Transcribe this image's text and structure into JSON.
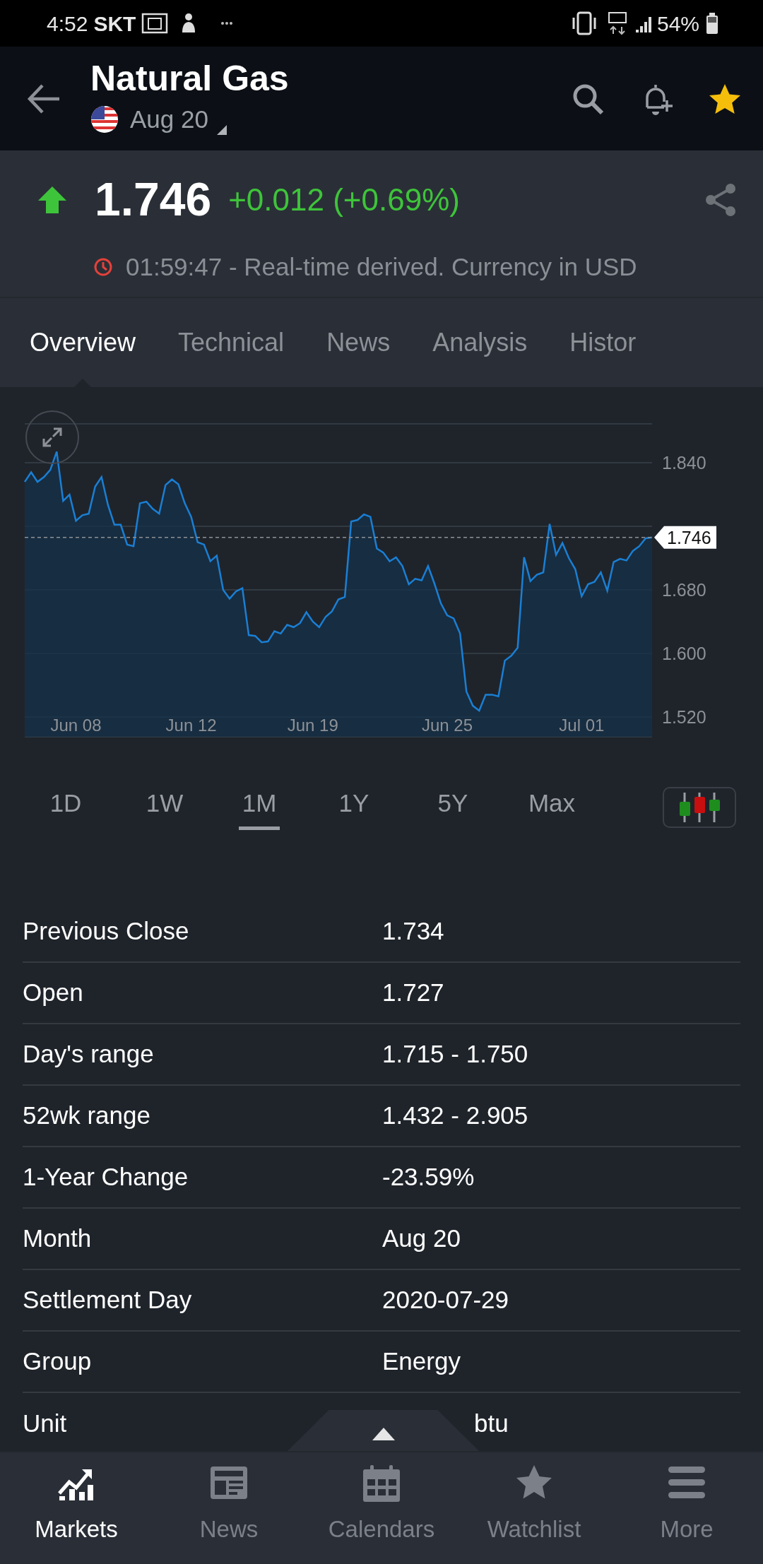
{
  "status_bar": {
    "time": "4:52",
    "carrier": "SKT",
    "battery": "54%"
  },
  "header": {
    "title": "Natural Gas",
    "contract": "Aug 20",
    "favorite": true
  },
  "quote": {
    "price": "1.746",
    "change": "+0.012 (+0.69%)",
    "up": true,
    "timestamp": "01:59:47 - Real-time derived. Currency in USD"
  },
  "tabs": [
    {
      "label": "Overview",
      "selected": true
    },
    {
      "label": "Technical",
      "selected": false
    },
    {
      "label": "News",
      "selected": false
    },
    {
      "label": "Analysis",
      "selected": false
    },
    {
      "label": "Histor",
      "selected": false
    }
  ],
  "chart": {
    "chart_data": {
      "type": "area",
      "ylim": [
        1.495,
        1.889
      ],
      "grid": true,
      "yticks": [
        {
          "value": 1.52,
          "label": "1.520"
        },
        {
          "value": 1.6,
          "label": "1.600"
        },
        {
          "value": 1.68,
          "label": "1.680"
        },
        {
          "value": 1.84,
          "label": "1.840"
        }
      ],
      "categories": [
        null,
        null,
        null,
        null,
        null,
        null,
        null,
        null,
        "Jun 08",
        null,
        null,
        null,
        null,
        null,
        null,
        null,
        null,
        null,
        null,
        null,
        null,
        null,
        null,
        null,
        null,
        null,
        "Jun 12",
        null,
        null,
        null,
        null,
        null,
        null,
        null,
        null,
        null,
        null,
        null,
        null,
        null,
        null,
        null,
        null,
        null,
        null,
        "Jun 19",
        null,
        null,
        null,
        null,
        null,
        null,
        null,
        null,
        null,
        null,
        null,
        null,
        null,
        null,
        null,
        null,
        null,
        null,
        null,
        null,
        "Jun 25",
        null,
        null,
        null,
        null,
        null,
        null,
        null,
        null,
        null,
        null,
        null,
        null,
        null,
        null,
        null,
        null,
        null,
        null,
        null,
        null,
        "Jul 01",
        null,
        null,
        null,
        null,
        null,
        null,
        null,
        null,
        null,
        null,
        null
      ],
      "series": [
        {
          "color": "#1a7fd4",
          "values": [
            1.816,
            1.828,
            1.816,
            1.822,
            1.831,
            1.854,
            1.792,
            1.8,
            1.767,
            1.774,
            1.776,
            1.81,
            1.822,
            1.787,
            1.762,
            1.762,
            1.737,
            1.735,
            1.789,
            1.791,
            1.782,
            1.776,
            1.812,
            1.819,
            1.813,
            1.789,
            1.772,
            1.74,
            1.737,
            1.716,
            1.723,
            1.68,
            1.669,
            1.678,
            1.682,
            1.623,
            1.622,
            1.614,
            1.615,
            1.628,
            1.625,
            1.636,
            1.633,
            1.638,
            1.652,
            1.64,
            1.633,
            1.646,
            1.653,
            1.668,
            1.671,
            1.766,
            1.768,
            1.775,
            1.772,
            1.732,
            1.727,
            1.716,
            1.721,
            1.71,
            1.687,
            1.694,
            1.692,
            1.71,
            1.688,
            1.663,
            1.648,
            1.644,
            1.625,
            1.552,
            1.534,
            1.528,
            1.548,
            1.548,
            1.546,
            1.591,
            1.597,
            1.607,
            1.721,
            1.691,
            1.699,
            1.702,
            1.763,
            1.724,
            1.739,
            1.72,
            1.706,
            1.672,
            1.687,
            1.69,
            1.702,
            1.679,
            1.715,
            1.719,
            1.717,
            1.729,
            1.735,
            1.745,
            1.746
          ]
        }
      ],
      "ref_lines": [
        {
          "axis": "y",
          "value": 1.746,
          "label": "1.746"
        }
      ]
    }
  },
  "periods": [
    {
      "label": "1D",
      "selected": false
    },
    {
      "label": "1W",
      "selected": false
    },
    {
      "label": "1M",
      "selected": true
    },
    {
      "label": "1Y",
      "selected": false
    },
    {
      "label": "5Y",
      "selected": false
    },
    {
      "label": "Max",
      "selected": false
    }
  ],
  "stats": [
    {
      "label": "Previous Close",
      "value": "1.734"
    },
    {
      "label": "Open",
      "value": "1.727"
    },
    {
      "label": "Day's range",
      "value": "1.715 - 1.750"
    },
    {
      "label": "52wk range",
      "value": "1.432 - 2.905"
    },
    {
      "label": "1-Year Change",
      "value": "-23.59%"
    },
    {
      "label": "Month",
      "value": "Aug 20"
    },
    {
      "label": "Settlement Day",
      "value": "2020-07-29"
    },
    {
      "label": "Group",
      "value": "Energy"
    },
    {
      "label": "Unit",
      "value": "btu"
    }
  ],
  "bottom_nav": [
    {
      "label": "Markets",
      "selected": true
    },
    {
      "label": "News",
      "selected": false
    },
    {
      "label": "Calendars",
      "selected": false
    },
    {
      "label": "Watchlist",
      "selected": false
    },
    {
      "label": "More",
      "selected": false
    }
  ]
}
